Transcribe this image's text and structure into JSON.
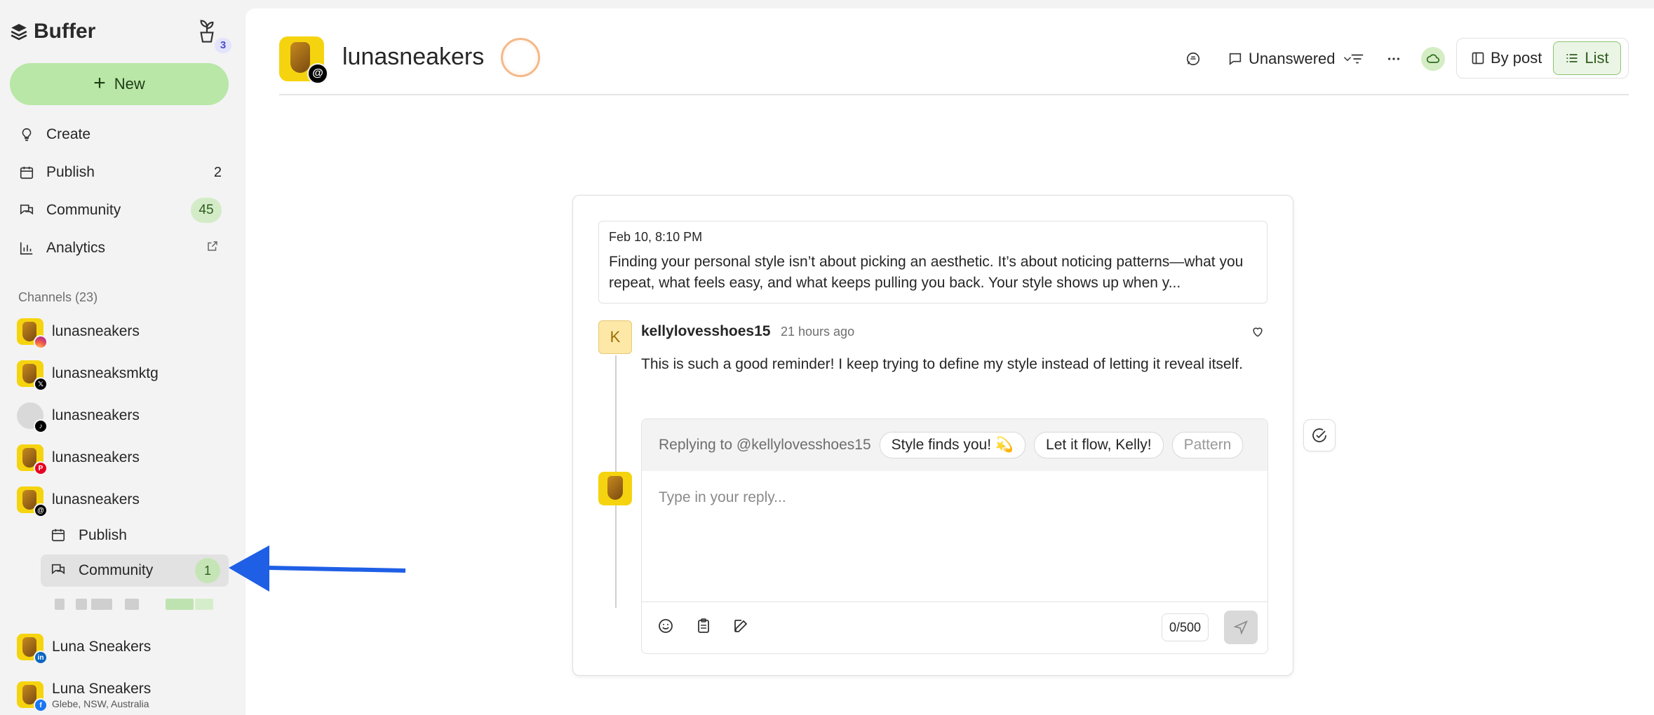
{
  "app": {
    "name": "Buffer",
    "plant_badge": "3",
    "new_label": "New"
  },
  "nav": [
    {
      "label": "Create",
      "icon": "lightbulb-icon"
    },
    {
      "label": "Publish",
      "icon": "calendar-icon",
      "count": "2"
    },
    {
      "label": "Community",
      "icon": "chat-bubbles-icon",
      "pill": "45"
    },
    {
      "label": "Analytics",
      "icon": "bar-chart-icon",
      "external": "external-link-icon"
    }
  ],
  "channels": {
    "label": "Channels (23)",
    "items": [
      {
        "name": "lunasneakers",
        "network": "instagram"
      },
      {
        "name": "lunasneaksmktg",
        "network": "x"
      },
      {
        "name": "lunasneakers",
        "network": "tiktok"
      },
      {
        "name": "lunasneakers",
        "network": "pinterest"
      },
      {
        "name": "lunasneakers",
        "network": "threads"
      },
      {
        "name": "Luna Sneakers",
        "network": "linkedin"
      },
      {
        "name": "Luna Sneakers",
        "network": "facebook",
        "sub": "Glebe, NSW, Australia"
      }
    ],
    "subnav": {
      "publish": "Publish",
      "community": "Community",
      "community_count": "1"
    }
  },
  "header": {
    "title": "lunasneakers",
    "filter_label": "Unanswered",
    "view_by_post": "By post",
    "view_list": "List"
  },
  "post": {
    "date": "Feb 10, 8:10 PM",
    "text": "Finding your personal style isn’t about picking an aesthetic. It’s about noticing patterns—what you repeat, what feels easy, and what keeps pulling you back. Your style shows up when y..."
  },
  "comment": {
    "avatar_letter": "K",
    "user": "kellylovesshoes15",
    "time": "21 hours ago",
    "text": "This is such a good reminder! I keep trying to define my style instead of letting it reveal itself."
  },
  "reply": {
    "replying_to": "Replying to @kellylovesshoes15",
    "chips": [
      "Style finds you! 💫",
      "Let it flow, Kelly!",
      "Pattern"
    ],
    "placeholder": "Type in your reply...",
    "char_count": "0/500"
  },
  "colors": {
    "accent_green": "#b9e7a7",
    "arrow_blue": "#1f5fe6",
    "brand_yellow": "#f5d40f"
  }
}
